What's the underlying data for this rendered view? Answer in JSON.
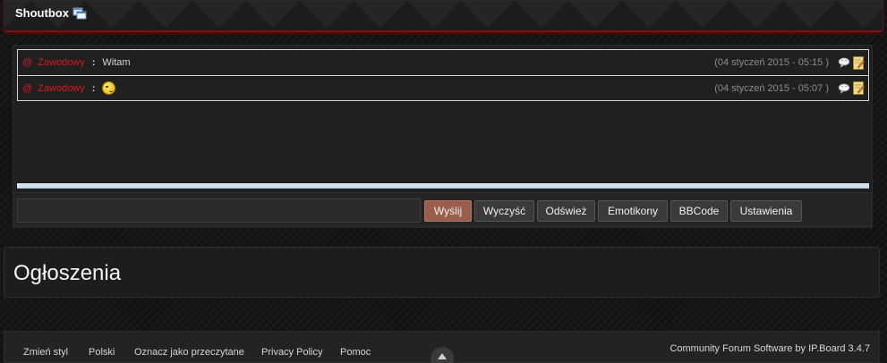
{
  "shoutbox": {
    "title": "Shoutbox",
    "title_icon": "windows-icon",
    "messages": [
      {
        "at": "@",
        "user": "Zawodowy",
        "sep": ":",
        "text": "Witam",
        "time": "(04 styczeń 2015 - 05:15 )"
      },
      {
        "at": "@",
        "user": "Zawodowy",
        "sep": ":",
        "emoji": "smiley-icon",
        "time": "(04 styczeń 2015 - 05:07 )"
      }
    ],
    "input": {
      "value": "",
      "placeholder": ""
    },
    "buttons": {
      "send": "Wyślij",
      "clear": "Wyczyść",
      "refresh": "Odśwież",
      "emoticons": "Emotikony",
      "bbcode": "BBCode",
      "settings": "Ustawienia"
    }
  },
  "announcements": {
    "title": "Ogłoszenia"
  },
  "footer": {
    "links": [
      "Zmień styl",
      "Polski",
      "Oznacz jako przeczytane",
      "Privacy Policy",
      "Pomoc"
    ],
    "credit": "Community Forum Software by IP.Board 3.4.7"
  },
  "colors": {
    "username": "#d21c1c",
    "send_button": "#9a5f4c",
    "header_accent": "#7a1010"
  }
}
